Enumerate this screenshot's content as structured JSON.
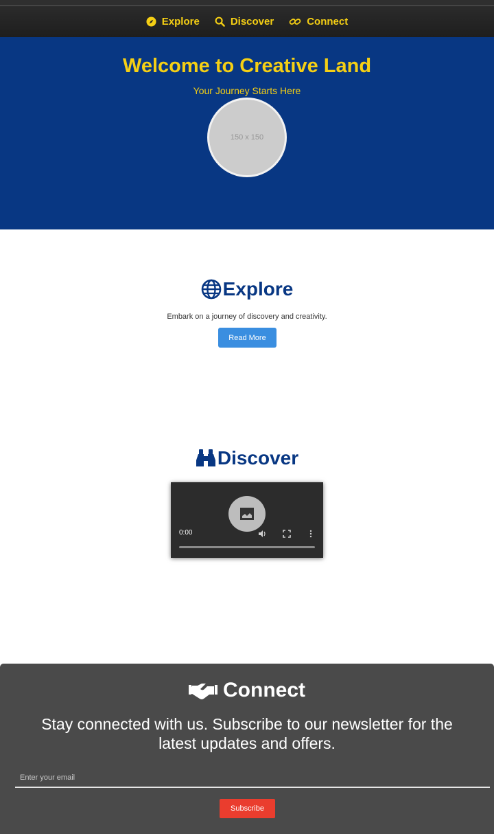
{
  "nav": {
    "items": [
      {
        "label": "Explore",
        "icon": "compass-icon"
      },
      {
        "label": "Discover",
        "icon": "search-icon"
      },
      {
        "label": "Connect",
        "icon": "link-icon"
      }
    ]
  },
  "hero": {
    "title": "Welcome to Creative Land",
    "subtitle": "Your Journey Starts Here",
    "avatar_placeholder": "150 x 150"
  },
  "explore": {
    "title": "Explore",
    "icon": "globe-icon",
    "description": "Embark on a journey of discovery and creativity.",
    "button_label": "Read More"
  },
  "discover": {
    "title": "Discover",
    "icon": "binoculars-icon",
    "video": {
      "time": "0:00"
    }
  },
  "connect": {
    "title": "Connect",
    "icon": "handshake-icon",
    "description": "Stay connected with us. Subscribe to our newsletter for the latest updates and offers.",
    "email_placeholder": "Enter your email",
    "button_label": "Subscribe"
  },
  "colors": {
    "accent_yellow": "#f5cf14",
    "hero_blue": "#083783",
    "button_blue": "#3a8ee0",
    "subscribe_red": "#ea3d2e",
    "connect_bg": "#4a4a4a"
  }
}
